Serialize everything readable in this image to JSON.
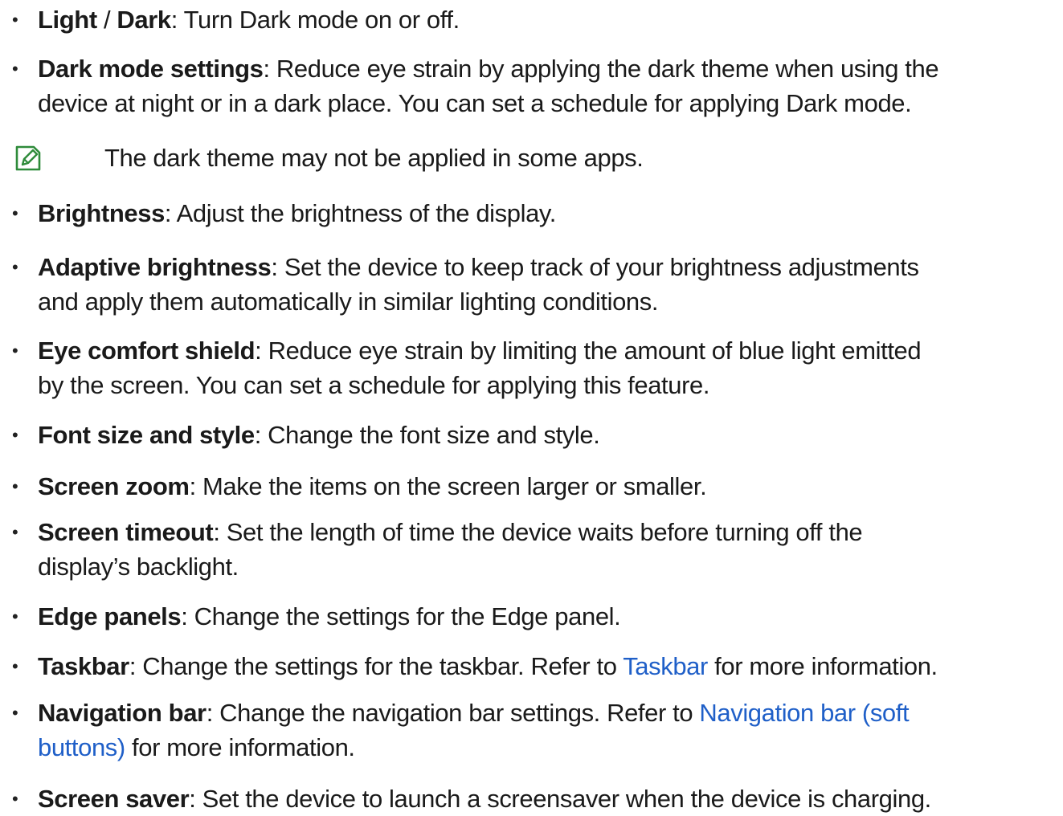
{
  "items": {
    "light_dark": {
      "term_a": "Light",
      "sep": " / ",
      "term_b": "Dark",
      "desc": ": Turn Dark mode on or off."
    },
    "dark_mode_settings": {
      "term": "Dark mode settings",
      "desc_line1": ": Reduce eye strain by applying the dark theme when using the",
      "desc_line2": "device at night or in a dark place. You can set a schedule for applying Dark mode."
    },
    "note": {
      "icon": "note-pencil-icon",
      "text": "The dark theme may not be applied in some apps."
    },
    "brightness": {
      "term": "Brightness",
      "desc": ": Adjust the brightness of the display."
    },
    "adaptive_brightness": {
      "term": "Adaptive brightness",
      "desc_line1": ": Set the device to keep track of your brightness adjustments",
      "desc_line2": "and apply them automatically in similar lighting conditions."
    },
    "eye_comfort": {
      "term": "Eye comfort shield",
      "desc_line1": ": Reduce eye strain by limiting the amount of blue light emitted",
      "desc_line2": "by the screen. You can set a schedule for applying this feature."
    },
    "font_size": {
      "term": "Font size and style",
      "desc": ": Change the font size and style."
    },
    "screen_zoom": {
      "term": "Screen zoom",
      "desc": ": Make the items on the screen larger or smaller."
    },
    "screen_timeout": {
      "term": "Screen timeout",
      "desc_line1": ": Set the length of time the device waits before turning off the",
      "desc_line2": "display’s backlight."
    },
    "edge_panels": {
      "term": "Edge panels",
      "desc": ": Change the settings for the Edge panel."
    },
    "taskbar": {
      "term": "Taskbar",
      "desc_a": ": Change the settings for the taskbar. Refer to ",
      "link": "Taskbar",
      "desc_b": " for more information."
    },
    "navigation_bar": {
      "term": "Navigation bar",
      "desc_a": ": Change the navigation bar settings. Refer to ",
      "link_line1": "Navigation bar (soft",
      "link_line2": "buttons)",
      "desc_b": " for more information."
    },
    "screen_saver": {
      "term": "Screen saver",
      "desc": ": Set the device to launch a screensaver when the device is charging."
    }
  },
  "bullet_char": "•",
  "colors": {
    "text": "#1a1a1a",
    "link": "#1f5fc8",
    "note_icon": "#2e8b3a"
  }
}
